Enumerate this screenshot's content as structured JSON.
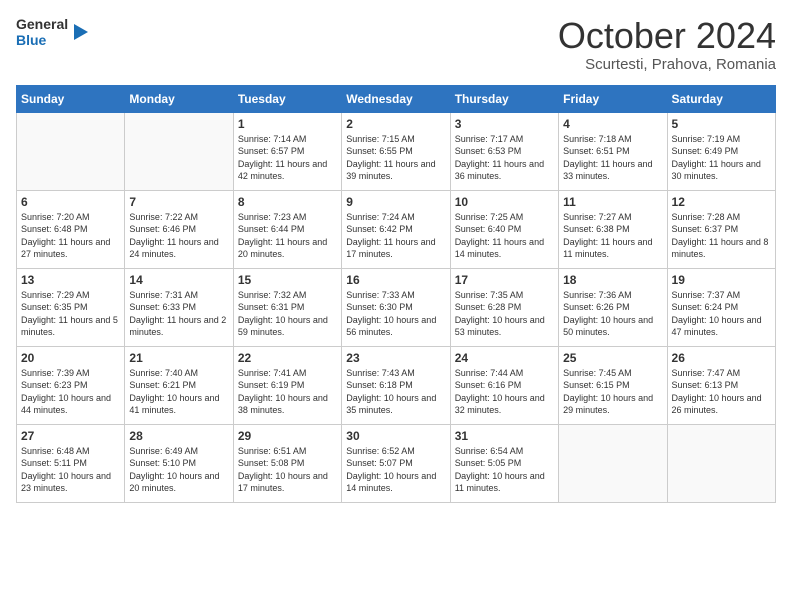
{
  "header": {
    "logo_general": "General",
    "logo_blue": "Blue",
    "month": "October 2024",
    "location": "Scurtesti, Prahova, Romania"
  },
  "days_of_week": [
    "Sunday",
    "Monday",
    "Tuesday",
    "Wednesday",
    "Thursday",
    "Friday",
    "Saturday"
  ],
  "weeks": [
    [
      {
        "day": "",
        "info": ""
      },
      {
        "day": "",
        "info": ""
      },
      {
        "day": "1",
        "info": "Sunrise: 7:14 AM\nSunset: 6:57 PM\nDaylight: 11 hours and 42 minutes."
      },
      {
        "day": "2",
        "info": "Sunrise: 7:15 AM\nSunset: 6:55 PM\nDaylight: 11 hours and 39 minutes."
      },
      {
        "day": "3",
        "info": "Sunrise: 7:17 AM\nSunset: 6:53 PM\nDaylight: 11 hours and 36 minutes."
      },
      {
        "day": "4",
        "info": "Sunrise: 7:18 AM\nSunset: 6:51 PM\nDaylight: 11 hours and 33 minutes."
      },
      {
        "day": "5",
        "info": "Sunrise: 7:19 AM\nSunset: 6:49 PM\nDaylight: 11 hours and 30 minutes."
      }
    ],
    [
      {
        "day": "6",
        "info": "Sunrise: 7:20 AM\nSunset: 6:48 PM\nDaylight: 11 hours and 27 minutes."
      },
      {
        "day": "7",
        "info": "Sunrise: 7:22 AM\nSunset: 6:46 PM\nDaylight: 11 hours and 24 minutes."
      },
      {
        "day": "8",
        "info": "Sunrise: 7:23 AM\nSunset: 6:44 PM\nDaylight: 11 hours and 20 minutes."
      },
      {
        "day": "9",
        "info": "Sunrise: 7:24 AM\nSunset: 6:42 PM\nDaylight: 11 hours and 17 minutes."
      },
      {
        "day": "10",
        "info": "Sunrise: 7:25 AM\nSunset: 6:40 PM\nDaylight: 11 hours and 14 minutes."
      },
      {
        "day": "11",
        "info": "Sunrise: 7:27 AM\nSunset: 6:38 PM\nDaylight: 11 hours and 11 minutes."
      },
      {
        "day": "12",
        "info": "Sunrise: 7:28 AM\nSunset: 6:37 PM\nDaylight: 11 hours and 8 minutes."
      }
    ],
    [
      {
        "day": "13",
        "info": "Sunrise: 7:29 AM\nSunset: 6:35 PM\nDaylight: 11 hours and 5 minutes."
      },
      {
        "day": "14",
        "info": "Sunrise: 7:31 AM\nSunset: 6:33 PM\nDaylight: 11 hours and 2 minutes."
      },
      {
        "day": "15",
        "info": "Sunrise: 7:32 AM\nSunset: 6:31 PM\nDaylight: 10 hours and 59 minutes."
      },
      {
        "day": "16",
        "info": "Sunrise: 7:33 AM\nSunset: 6:30 PM\nDaylight: 10 hours and 56 minutes."
      },
      {
        "day": "17",
        "info": "Sunrise: 7:35 AM\nSunset: 6:28 PM\nDaylight: 10 hours and 53 minutes."
      },
      {
        "day": "18",
        "info": "Sunrise: 7:36 AM\nSunset: 6:26 PM\nDaylight: 10 hours and 50 minutes."
      },
      {
        "day": "19",
        "info": "Sunrise: 7:37 AM\nSunset: 6:24 PM\nDaylight: 10 hours and 47 minutes."
      }
    ],
    [
      {
        "day": "20",
        "info": "Sunrise: 7:39 AM\nSunset: 6:23 PM\nDaylight: 10 hours and 44 minutes."
      },
      {
        "day": "21",
        "info": "Sunrise: 7:40 AM\nSunset: 6:21 PM\nDaylight: 10 hours and 41 minutes."
      },
      {
        "day": "22",
        "info": "Sunrise: 7:41 AM\nSunset: 6:19 PM\nDaylight: 10 hours and 38 minutes."
      },
      {
        "day": "23",
        "info": "Sunrise: 7:43 AM\nSunset: 6:18 PM\nDaylight: 10 hours and 35 minutes."
      },
      {
        "day": "24",
        "info": "Sunrise: 7:44 AM\nSunset: 6:16 PM\nDaylight: 10 hours and 32 minutes."
      },
      {
        "day": "25",
        "info": "Sunrise: 7:45 AM\nSunset: 6:15 PM\nDaylight: 10 hours and 29 minutes."
      },
      {
        "day": "26",
        "info": "Sunrise: 7:47 AM\nSunset: 6:13 PM\nDaylight: 10 hours and 26 minutes."
      }
    ],
    [
      {
        "day": "27",
        "info": "Sunrise: 6:48 AM\nSunset: 5:11 PM\nDaylight: 10 hours and 23 minutes."
      },
      {
        "day": "28",
        "info": "Sunrise: 6:49 AM\nSunset: 5:10 PM\nDaylight: 10 hours and 20 minutes."
      },
      {
        "day": "29",
        "info": "Sunrise: 6:51 AM\nSunset: 5:08 PM\nDaylight: 10 hours and 17 minutes."
      },
      {
        "day": "30",
        "info": "Sunrise: 6:52 AM\nSunset: 5:07 PM\nDaylight: 10 hours and 14 minutes."
      },
      {
        "day": "31",
        "info": "Sunrise: 6:54 AM\nSunset: 5:05 PM\nDaylight: 10 hours and 11 minutes."
      },
      {
        "day": "",
        "info": ""
      },
      {
        "day": "",
        "info": ""
      }
    ]
  ]
}
